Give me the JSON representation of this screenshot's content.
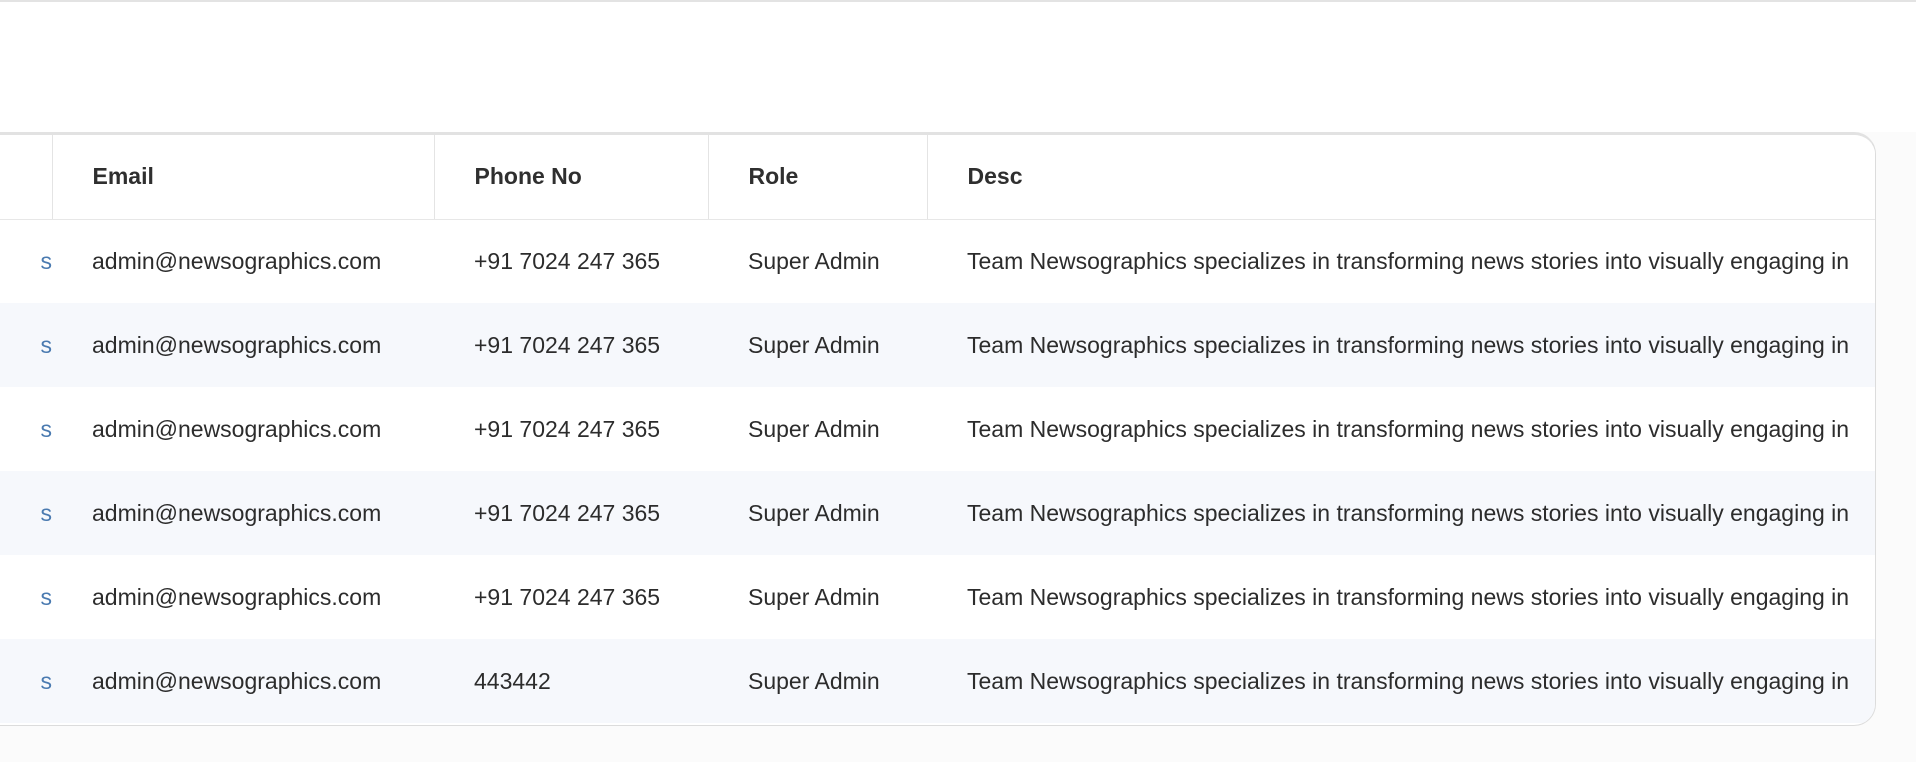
{
  "table": {
    "columns": [
      "",
      "Email",
      "Phone No",
      "Role",
      "Desc"
    ],
    "rows": [
      {
        "name": "s",
        "email": "admin@newsographics.com",
        "phone": "+91 7024 247 365",
        "role": "Super Admin",
        "desc": "Team Newsographics specializes in transforming news stories into visually engaging in"
      },
      {
        "name": "s",
        "email": "admin@newsographics.com",
        "phone": "+91 7024 247 365",
        "role": "Super Admin",
        "desc": "Team Newsographics specializes in transforming news stories into visually engaging in"
      },
      {
        "name": "s",
        "email": "admin@newsographics.com",
        "phone": "+91 7024 247 365",
        "role": "Super Admin",
        "desc": "Team Newsographics specializes in transforming news stories into visually engaging in"
      },
      {
        "name": "s",
        "email": "admin@newsographics.com",
        "phone": "+91 7024 247 365",
        "role": "Super Admin",
        "desc": "Team Newsographics specializes in transforming news stories into visually engaging in"
      },
      {
        "name": "s",
        "email": "admin@newsographics.com",
        "phone": "+91 7024 247 365",
        "role": "Super Admin",
        "desc": "Team Newsographics specializes in transforming news stories into visually engaging in"
      },
      {
        "name": "s",
        "email": "admin@newsographics.com",
        "phone": "443442",
        "role": "Super Admin",
        "desc": "Team Newsographics specializes in transforming news stories into visually engaging in"
      }
    ]
  },
  "colors": {
    "link": "#4a7ab0",
    "stripe": "#f6f8fc",
    "border": "#dcdcdc"
  }
}
